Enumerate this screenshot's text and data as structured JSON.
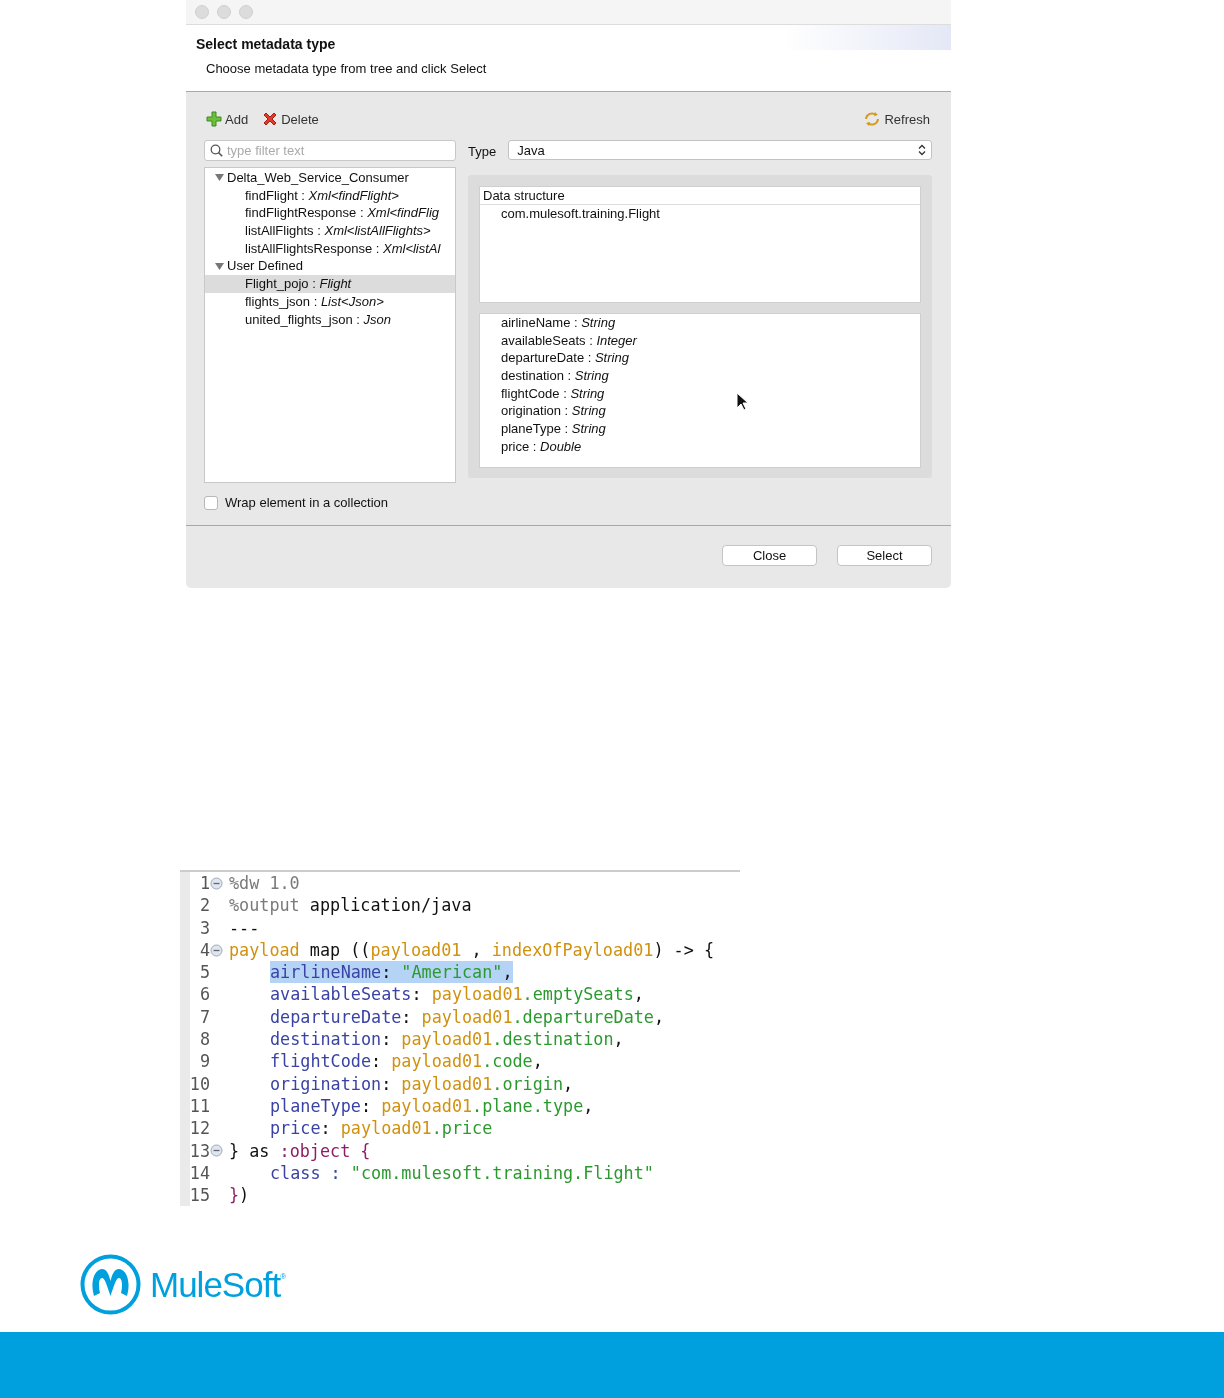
{
  "dialog": {
    "title": "Select metadata type",
    "subtitle": "Choose metadata type from tree and click Select",
    "toolbar": [
      {
        "kind": "add",
        "label": "Add"
      },
      {
        "kind": "delete",
        "label": "Delete"
      },
      {
        "kind": "refresh",
        "label": "Refresh"
      }
    ],
    "filter": {
      "placeholder": "type filter text"
    },
    "type_field": {
      "label": "Type",
      "value": "Java"
    },
    "tree": [
      {
        "text": "Delta_Web_Service_Consumer",
        "expanded": true,
        "children": [
          {
            "text": "findFlight : *Xml<findFlight>*",
            "selected": false
          },
          {
            "text": "findFlightResponse : *Xml<findFlig*",
            "selected": false
          },
          {
            "text": "listAllFlights : *Xml<listAllFlights>*",
            "selected": false
          },
          {
            "text": "listAllFlightsResponse : *Xml<listAl*",
            "selected": false
          }
        ]
      },
      {
        "text": "User Defined",
        "expanded": true,
        "children": [
          {
            "text": "Flight_pojo : *Flight*",
            "selected": true
          },
          {
            "text": "flights_json : *List<Json>*",
            "selected": false
          },
          {
            "text": "united_flights_json : *Json*",
            "selected": false
          }
        ]
      }
    ],
    "data_structure": {
      "heading": "Data structure",
      "class_name": "com.mulesoft.training.Flight",
      "fields": [
        "airlineName : *String*",
        "availableSeats : *Integer*",
        "departureDate : *String*",
        "destination : *String*",
        "flightCode : *String*",
        "origination : *String*",
        "planeType : *String*",
        "price : *Double*"
      ]
    },
    "wrap_checkbox": {
      "label": "Wrap element in a collection",
      "checked": false
    },
    "buttons": [
      "Close",
      "Select"
    ]
  },
  "code_editor": {
    "lines": [
      {
        "number": "1",
        "fold": true,
        "indent": false,
        "selected": false,
        "tokens": [
          {
            "t": "%dw 1.0",
            "kind": "meta"
          }
        ]
      },
      {
        "number": "2",
        "fold": false,
        "indent": false,
        "selected": false,
        "tokens": [
          {
            "t": "%output ",
            "kind": "meta"
          },
          {
            "t": "application/java",
            "kind": "plain"
          }
        ]
      },
      {
        "number": "3",
        "fold": false,
        "indent": false,
        "selected": false,
        "tokens": [
          {
            "t": "---",
            "kind": "plain"
          }
        ]
      },
      {
        "number": "4",
        "fold": true,
        "indent": false,
        "selected": false,
        "tokens": [
          {
            "t": "payload",
            "kind": "var"
          },
          {
            "t": " map ((",
            "kind": "plain"
          },
          {
            "t": "payload01",
            "kind": "var"
          },
          {
            "t": " , ",
            "kind": "plain"
          },
          {
            "t": "indexOfPayload01",
            "kind": "var"
          },
          {
            "t": ") -> {",
            "kind": "plain"
          }
        ]
      },
      {
        "number": "5",
        "fold": false,
        "indent": true,
        "selected": true,
        "tokens": [
          {
            "t": "airlineName",
            "kind": "key"
          },
          {
            "t": ": ",
            "kind": "plain"
          },
          {
            "t": "\"American\"",
            "kind": "str"
          },
          {
            "t": ",",
            "kind": "plain"
          }
        ]
      },
      {
        "number": "6",
        "fold": false,
        "indent": true,
        "selected": false,
        "tokens": [
          {
            "t": "availableSeats",
            "kind": "key"
          },
          {
            "t": ": ",
            "kind": "plain"
          },
          {
            "t": "payload01",
            "kind": "var"
          },
          {
            "t": ".emptySeats",
            "kind": "str"
          },
          {
            "t": ",",
            "kind": "plain"
          }
        ]
      },
      {
        "number": "7",
        "fold": false,
        "indent": true,
        "selected": false,
        "tokens": [
          {
            "t": "departureDate",
            "kind": "key"
          },
          {
            "t": ": ",
            "kind": "plain"
          },
          {
            "t": "payload01",
            "kind": "var"
          },
          {
            "t": ".departureDate",
            "kind": "str"
          },
          {
            "t": ",",
            "kind": "plain"
          }
        ]
      },
      {
        "number": "8",
        "fold": false,
        "indent": true,
        "selected": false,
        "tokens": [
          {
            "t": "destination",
            "kind": "key"
          },
          {
            "t": ": ",
            "kind": "plain"
          },
          {
            "t": "payload01",
            "kind": "var"
          },
          {
            "t": ".destination",
            "kind": "str"
          },
          {
            "t": ",",
            "kind": "plain"
          }
        ]
      },
      {
        "number": "9",
        "fold": false,
        "indent": true,
        "selected": false,
        "tokens": [
          {
            "t": "flightCode",
            "kind": "key"
          },
          {
            "t": ": ",
            "kind": "plain"
          },
          {
            "t": "payload01",
            "kind": "var"
          },
          {
            "t": ".code",
            "kind": "str"
          },
          {
            "t": ",",
            "kind": "plain"
          }
        ]
      },
      {
        "number": "10",
        "fold": false,
        "indent": true,
        "selected": false,
        "tokens": [
          {
            "t": "origination",
            "kind": "key"
          },
          {
            "t": ": ",
            "kind": "plain"
          },
          {
            "t": "payload01",
            "kind": "var"
          },
          {
            "t": ".origin",
            "kind": "str"
          },
          {
            "t": ",",
            "kind": "plain"
          }
        ]
      },
      {
        "number": "11",
        "fold": false,
        "indent": true,
        "selected": false,
        "tokens": [
          {
            "t": "planeType",
            "kind": "key"
          },
          {
            "t": ": ",
            "kind": "plain"
          },
          {
            "t": "payload01",
            "kind": "var"
          },
          {
            "t": ".plane.type",
            "kind": "str"
          },
          {
            "t": ",",
            "kind": "plain"
          }
        ]
      },
      {
        "number": "12",
        "fold": false,
        "indent": true,
        "selected": false,
        "tokens": [
          {
            "t": "price",
            "kind": "key"
          },
          {
            "t": ": ",
            "kind": "plain"
          },
          {
            "t": "payload01",
            "kind": "var"
          },
          {
            "t": ".price",
            "kind": "str"
          }
        ]
      },
      {
        "number": "13",
        "fold": true,
        "indent": false,
        "selected": false,
        "tokens": [
          {
            "t": "} as ",
            "kind": "plain"
          },
          {
            "t": ":object {",
            "kind": "type"
          }
        ]
      },
      {
        "number": "14",
        "fold": false,
        "indent": true,
        "selected": false,
        "tokens": [
          {
            "t": "class : ",
            "kind": "key"
          },
          {
            "t": "\"com.mulesoft.training.Flight\"",
            "kind": "str"
          }
        ]
      },
      {
        "number": "15",
        "fold": false,
        "indent": false,
        "selected": false,
        "tokens": [
          {
            "t": "}",
            "kind": "type"
          },
          {
            "t": ")",
            "kind": "plain"
          }
        ]
      }
    ]
  },
  "logo": {
    "text": "MuleSoft$^{®}$"
  }
}
